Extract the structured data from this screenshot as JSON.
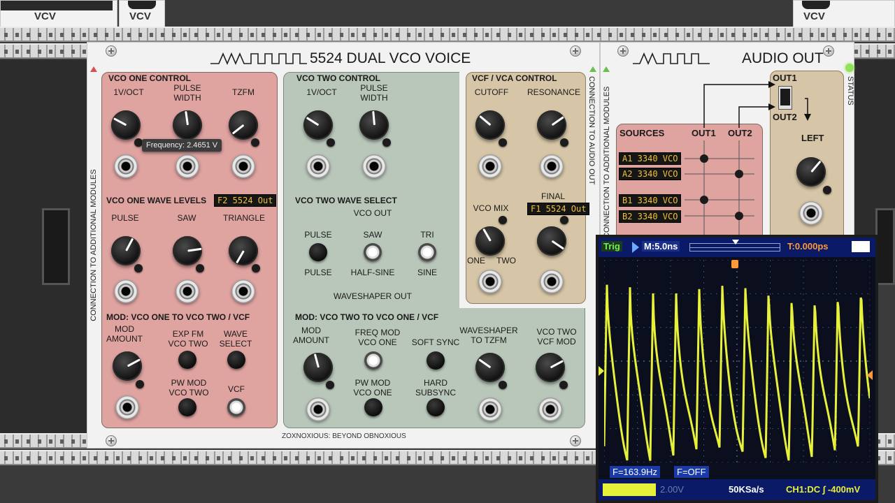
{
  "top_modules": {
    "left_brand": "VCV",
    "left_brand2": "VCV",
    "right_brand": "VCV"
  },
  "vco_module": {
    "title": "5524 DUAL VCO VOICE",
    "footer": "ZOXNOXIOUS: BEYOND OBNOXIOUS",
    "left_side_text": "CONNECTION TO ADDITIONAL MODULES",
    "right_side_text": "CONNECTION TO AUDIO OUT",
    "vco_one": {
      "header": "VCO ONE CONTROL",
      "labels": [
        "1V/OCT",
        "PULSE\nWIDTH",
        "TZFM"
      ],
      "tooltip": "Frequency: 2.4651 V",
      "wave_levels_header": "VCO ONE WAVE LEVELS",
      "wave_display": "F2 5524 Out",
      "wave_labels": [
        "PULSE",
        "SAW",
        "TRIANGLE"
      ]
    },
    "mod_one": {
      "header": "MOD: VCO ONE TO VCO TWO / VCF",
      "mod_amount": "MOD\nAMOUNT",
      "exp_fm": "EXP FM\nVCO TWO",
      "wave_select": "WAVE\nSELECT",
      "pw_mod": "PW MOD\nVCO TWO",
      "vcf": "VCF"
    },
    "vco_two": {
      "header": "VCO TWO CONTROL",
      "labels": [
        "1V/OCT",
        "PULSE\nWIDTH"
      ],
      "wave_select_header": "VCO TWO WAVE SELECT",
      "vco_out": "VCO OUT",
      "top_labels": [
        "PULSE",
        "SAW",
        "TRI"
      ],
      "bottom_labels": [
        "PULSE",
        "HALF-SINE",
        "SINE"
      ],
      "waveshaper_out": "WAVESHAPER OUT"
    },
    "mod_two": {
      "header": "MOD: VCO TWO TO VCO ONE / VCF",
      "mod_amount": "MOD\nAMOUNT",
      "freq_mod": "FREQ MOD\nVCO ONE",
      "soft_sync": "SOFT SYNC",
      "waveshaper_tzfm": "WAVESHAPER\nTO TZFM",
      "vco_two_vcf": "VCO TWO\nVCF MOD",
      "pw_mod": "PW MOD\nVCO ONE",
      "hard_subsync": "HARD\nSUBSYNC"
    },
    "vcf": {
      "header": "VCF / VCA CONTROL",
      "cutoff": "CUTOFF",
      "resonance": "RESONANCE",
      "vco_mix": "VCO MIX",
      "final_gain": "FINAL GAIN",
      "gain_display": "F1 5524 Out",
      "one": "ONE",
      "two": "TWO"
    }
  },
  "audio_module": {
    "title": "AUDIO OUT",
    "sources_header": "SOURCES",
    "out1": "OUT1",
    "out2": "OUT2",
    "sources": [
      "A1 3340 VCO",
      "A2 3340 VCO",
      "B1 3340 VCO",
      "B2 3340 VCO"
    ],
    "out_label1": "OUT1",
    "out_label2": "OUT2",
    "left": "LEFT",
    "status": "STATUS",
    "side_text": "CONNECTION TO ADDITIONAL MODULES"
  },
  "scope": {
    "trig": "Trig",
    "timebase": "M:5.0ns",
    "trigger_time": "T:0.000ps",
    "freq": "F=163.9Hz",
    "f_off": "F=OFF",
    "ch2": "2.00V",
    "sample_rate": "50KSa/s",
    "ch1": "CH1:DC ∫ -400mV",
    "trace_color": "#e7f13a"
  }
}
